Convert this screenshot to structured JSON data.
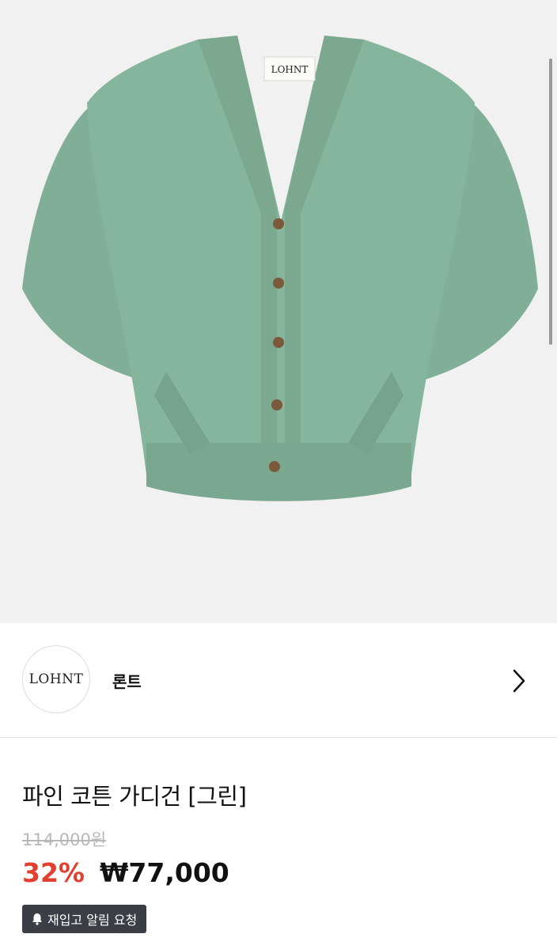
{
  "product_image": {
    "label_text": "LOHNT",
    "colors": {
      "background": "#f1f1f1",
      "garment": "#86b59d",
      "garment_shadow": "#78a68e",
      "buttons": "#7a5a3a"
    }
  },
  "brand": {
    "logo_text": "LOHNT",
    "name": "론트"
  },
  "product": {
    "title": "파인 코튼 가디건 [그린]",
    "original_price": "114,000원",
    "discount_rate": "32%",
    "sale_price": "₩77,000"
  },
  "restock": {
    "label": "재입고 알림 요청"
  },
  "colors": {
    "discount": "#e0402f",
    "button_bg": "#3b3e45"
  }
}
